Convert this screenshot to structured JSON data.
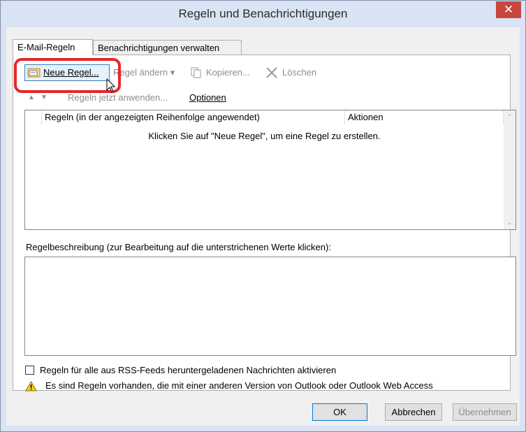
{
  "window": {
    "title": "Regeln und Benachrichtigungen",
    "close_glyph": "✕"
  },
  "tabs": [
    {
      "label": "E-Mail-Regeln",
      "active": true
    },
    {
      "label": "Benachrichtigungen verwalten",
      "active": false
    }
  ],
  "toolbar": {
    "new_rule": "Neue Regel...",
    "change_rule": "Regel ändern",
    "change_rule_caret": "▾",
    "copy": "Kopieren...",
    "delete": "Löschen",
    "apply_now": "Regeln jetzt anwenden...",
    "options": "Optionen"
  },
  "rules_list": {
    "columns": [
      "Regeln (in der angezeigten Reihenfolge angewendet)",
      "Aktionen"
    ],
    "empty_message": "Klicken Sie auf \"Neue Regel\", um eine Regel zu erstellen."
  },
  "description": {
    "label": "Regelbeschreibung (zur Bearbeitung auf die unterstrichenen Werte klicken):"
  },
  "rss_checkbox": {
    "label": "Regeln für alle aus RSS-Feeds heruntergeladenen Nachrichten aktivieren",
    "checked": false
  },
  "warning": {
    "text": "Es sind Regeln vorhanden, die mit einer anderen Version von Outlook oder Outlook Web Access"
  },
  "buttons": {
    "ok": "OK",
    "cancel": "Abbrechen",
    "apply": "Übernehmen"
  },
  "colors": {
    "highlight": "#e8252a",
    "titlebar": "#d9e3f4",
    "close": "#c7463f",
    "hover": "#e5f1fb"
  }
}
